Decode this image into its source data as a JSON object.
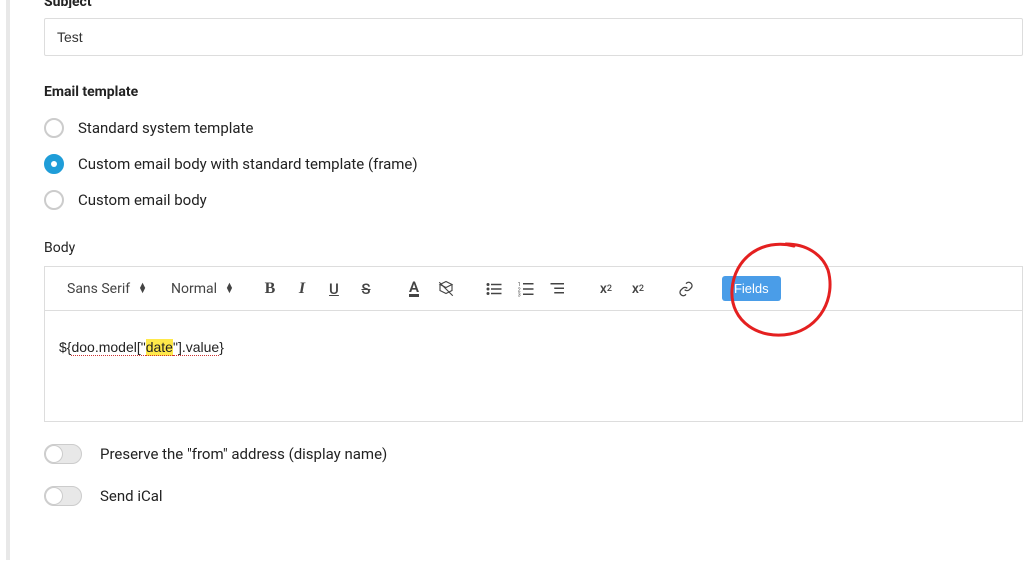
{
  "subject": {
    "label": "Subject",
    "value": "Test"
  },
  "emailTemplate": {
    "label": "Email template",
    "options": [
      {
        "label": "Standard system template",
        "selected": false
      },
      {
        "label": "Custom email body with standard template (frame)",
        "selected": true
      },
      {
        "label": "Custom email body",
        "selected": false
      }
    ]
  },
  "body": {
    "label": "Body",
    "toolbar": {
      "font": "Sans Serif",
      "size": "Normal",
      "fields_btn": "Fields"
    },
    "content": {
      "prefix": "${",
      "part1": "doo.model[\"",
      "highlighted": "date",
      "part2": "\"].value",
      "suffix": "}"
    }
  },
  "toggles": {
    "preserveFrom": "Preserve the \"from\" address (display name)",
    "sendIcal": "Send iCal"
  }
}
